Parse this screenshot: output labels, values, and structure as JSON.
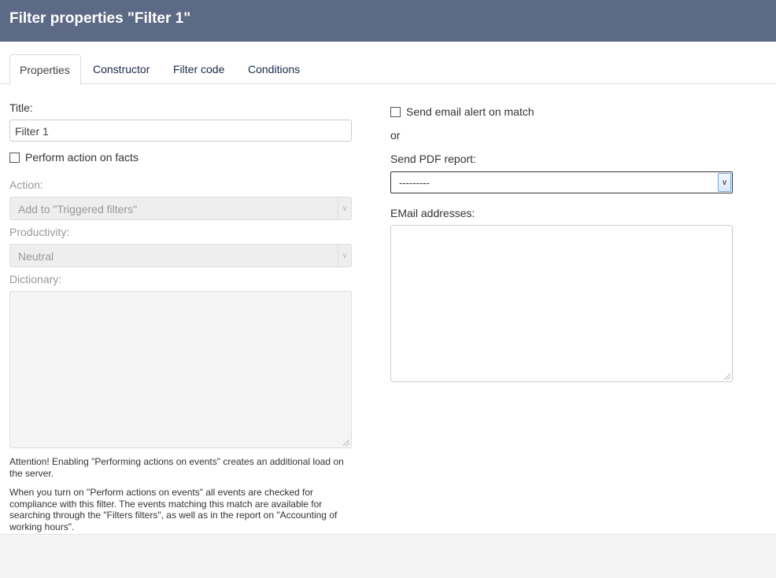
{
  "window": {
    "title": "Filter properties \"Filter 1\""
  },
  "tabs": [
    {
      "label": "Properties",
      "active": true
    },
    {
      "label": "Constructor",
      "active": false
    },
    {
      "label": "Filter code",
      "active": false
    },
    {
      "label": "Conditions",
      "active": false
    }
  ],
  "left": {
    "title_label": "Title:",
    "title_value": "Filter 1",
    "perform_action_label": "Perform action on facts",
    "perform_action_checked": false,
    "action_label": "Action:",
    "action_value": "Add to \"Triggered filters\"",
    "productivity_label": "Productivity:",
    "productivity_value": "Neutral",
    "dictionary_label": "Dictionary:",
    "note_attention": "Attention! Enabling \"Performing actions on events\" creates an additional load on the server.",
    "note_info": "When you turn on \"Perform actions on events\" all events are checked for compliance with this filter. The events matching this match are available for searching through the \"Filters filters\", as well as in the report on \"Accounting of working hours\"."
  },
  "right": {
    "email_alert_label": "Send email alert on match",
    "email_alert_checked": false,
    "or_text": "or",
    "pdf_report_label": "Send PDF report:",
    "pdf_report_value": "---------",
    "email_addresses_label": "EMail addresses:"
  },
  "icons": {
    "dropdown_arrow": "chevron-down-icon",
    "resize_grip": "resize-grip-icon"
  },
  "colors": {
    "titlebar_bg": "#5c6a86",
    "footer_bg": "#f4f4f4"
  }
}
